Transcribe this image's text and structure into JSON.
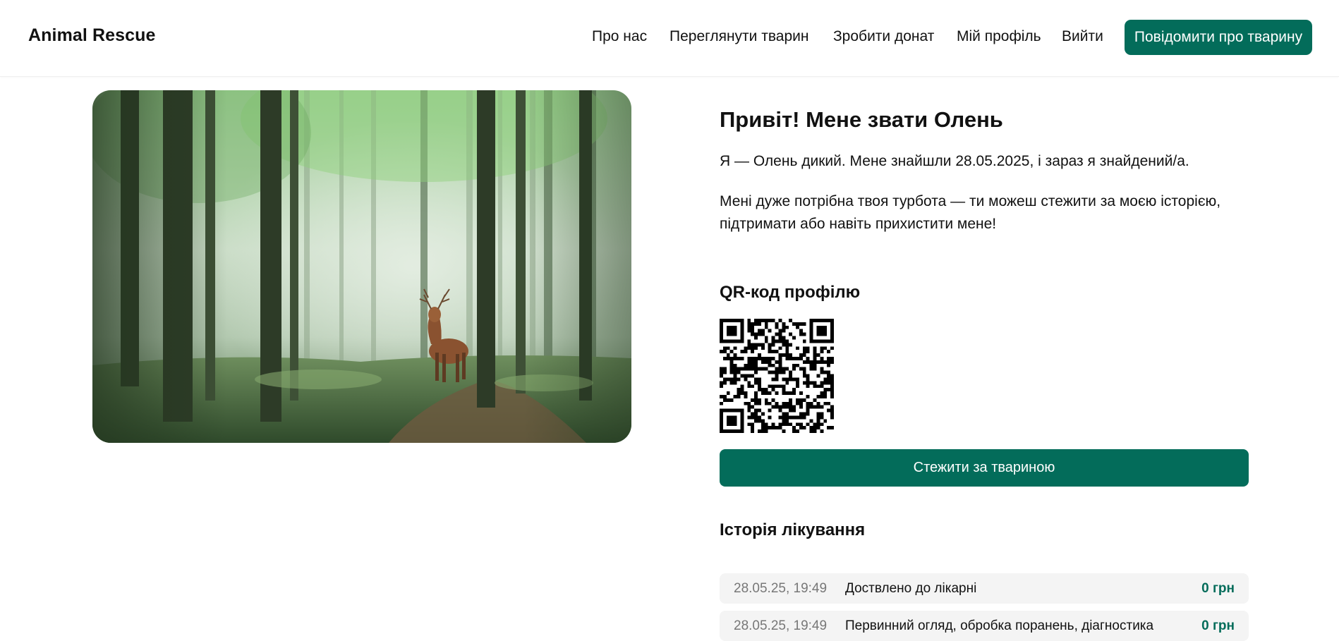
{
  "header": {
    "brand": "Animal Rescue",
    "nav": [
      {
        "label": "Про нас"
      },
      {
        "label": "Переглянути тварин"
      },
      {
        "label": "Зробити донат"
      },
      {
        "label": "Мій профіль"
      },
      {
        "label": "Вийти"
      }
    ],
    "report_button": "Повідомити про тварину"
  },
  "animal": {
    "title": "Привіт! Мене звати Олень",
    "intro": "Я — Олень дикий. Мене знайшли 28.05.2025, і зараз я знайдений/а.",
    "appeal": "Мені дуже потрібна твоя турбота — ти можеш стежити за моєю історією, підтримати або навіть прихистити мене!"
  },
  "qr": {
    "heading": "QR-код профілю"
  },
  "follow_button": "Стежити за твариною",
  "history": {
    "heading": "Історія лікування",
    "rows": [
      {
        "date": "28.05.25, 19:49",
        "description": "Доствлено до лікарні",
        "amount": "0 грн"
      },
      {
        "date": "28.05.25, 19:49",
        "description": "Первинний огляд, обробка поранень, діагностика",
        "amount": "0 грн"
      }
    ]
  },
  "colors": {
    "accent": "#036c5a",
    "row_background": "#f4f4f4",
    "muted_text": "#777777"
  },
  "icons": {
    "photo": "deer-in-forest-photo",
    "qr": "qr-code"
  }
}
